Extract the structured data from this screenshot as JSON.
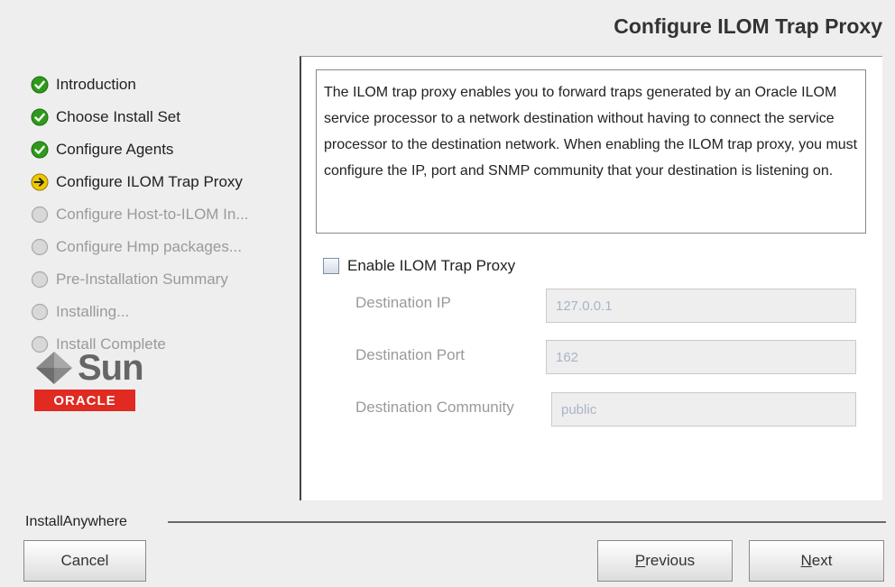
{
  "header": {
    "title": "Configure ILOM Trap Proxy"
  },
  "steps": [
    {
      "label": "Introduction",
      "status": "done"
    },
    {
      "label": "Choose Install Set",
      "status": "done"
    },
    {
      "label": "Configure Agents",
      "status": "done"
    },
    {
      "label": "Configure ILOM Trap Proxy",
      "status": "current"
    },
    {
      "label": "Configure Host-to-ILOM In...",
      "status": "pending"
    },
    {
      "label": "Configure Hmp packages...",
      "status": "pending"
    },
    {
      "label": "Pre-Installation Summary",
      "status": "pending"
    },
    {
      "label": "Installing...",
      "status": "pending"
    },
    {
      "label": "Install Complete",
      "status": "pending"
    }
  ],
  "logos": {
    "sun": "Sun",
    "oracle": "ORACLE"
  },
  "description": "The ILOM trap proxy enables you to forward traps generated by an Oracle ILOM service processor to a network destination without having to connect the service processor to the destination network. When enabling the ILOM trap proxy, you must configure the IP, port and SNMP community that your destination is listening on.",
  "form": {
    "enable_label": "Enable ILOM Trap Proxy",
    "enable_checked": false,
    "fields": [
      {
        "label": "Destination IP",
        "value": "127.0.0.1"
      },
      {
        "label": "Destination Port",
        "value": "162"
      },
      {
        "label": "Destination Community",
        "value": "public"
      }
    ]
  },
  "footer": {
    "brand": "InstallAnywhere",
    "cancel_label": "Cancel",
    "previous_mnemonic": "P",
    "previous_rest": "revious",
    "next_mnemonic": "N",
    "next_rest": "ext"
  },
  "colors": {
    "done": "#2e9a1a",
    "current": "#f0c800",
    "pending": "#c9c9c9",
    "oracle_red": "#e02a22"
  },
  "icons": {
    "done": "checkmark-circle-icon",
    "current": "arrow-circle-icon",
    "pending": "empty-circle-icon"
  }
}
